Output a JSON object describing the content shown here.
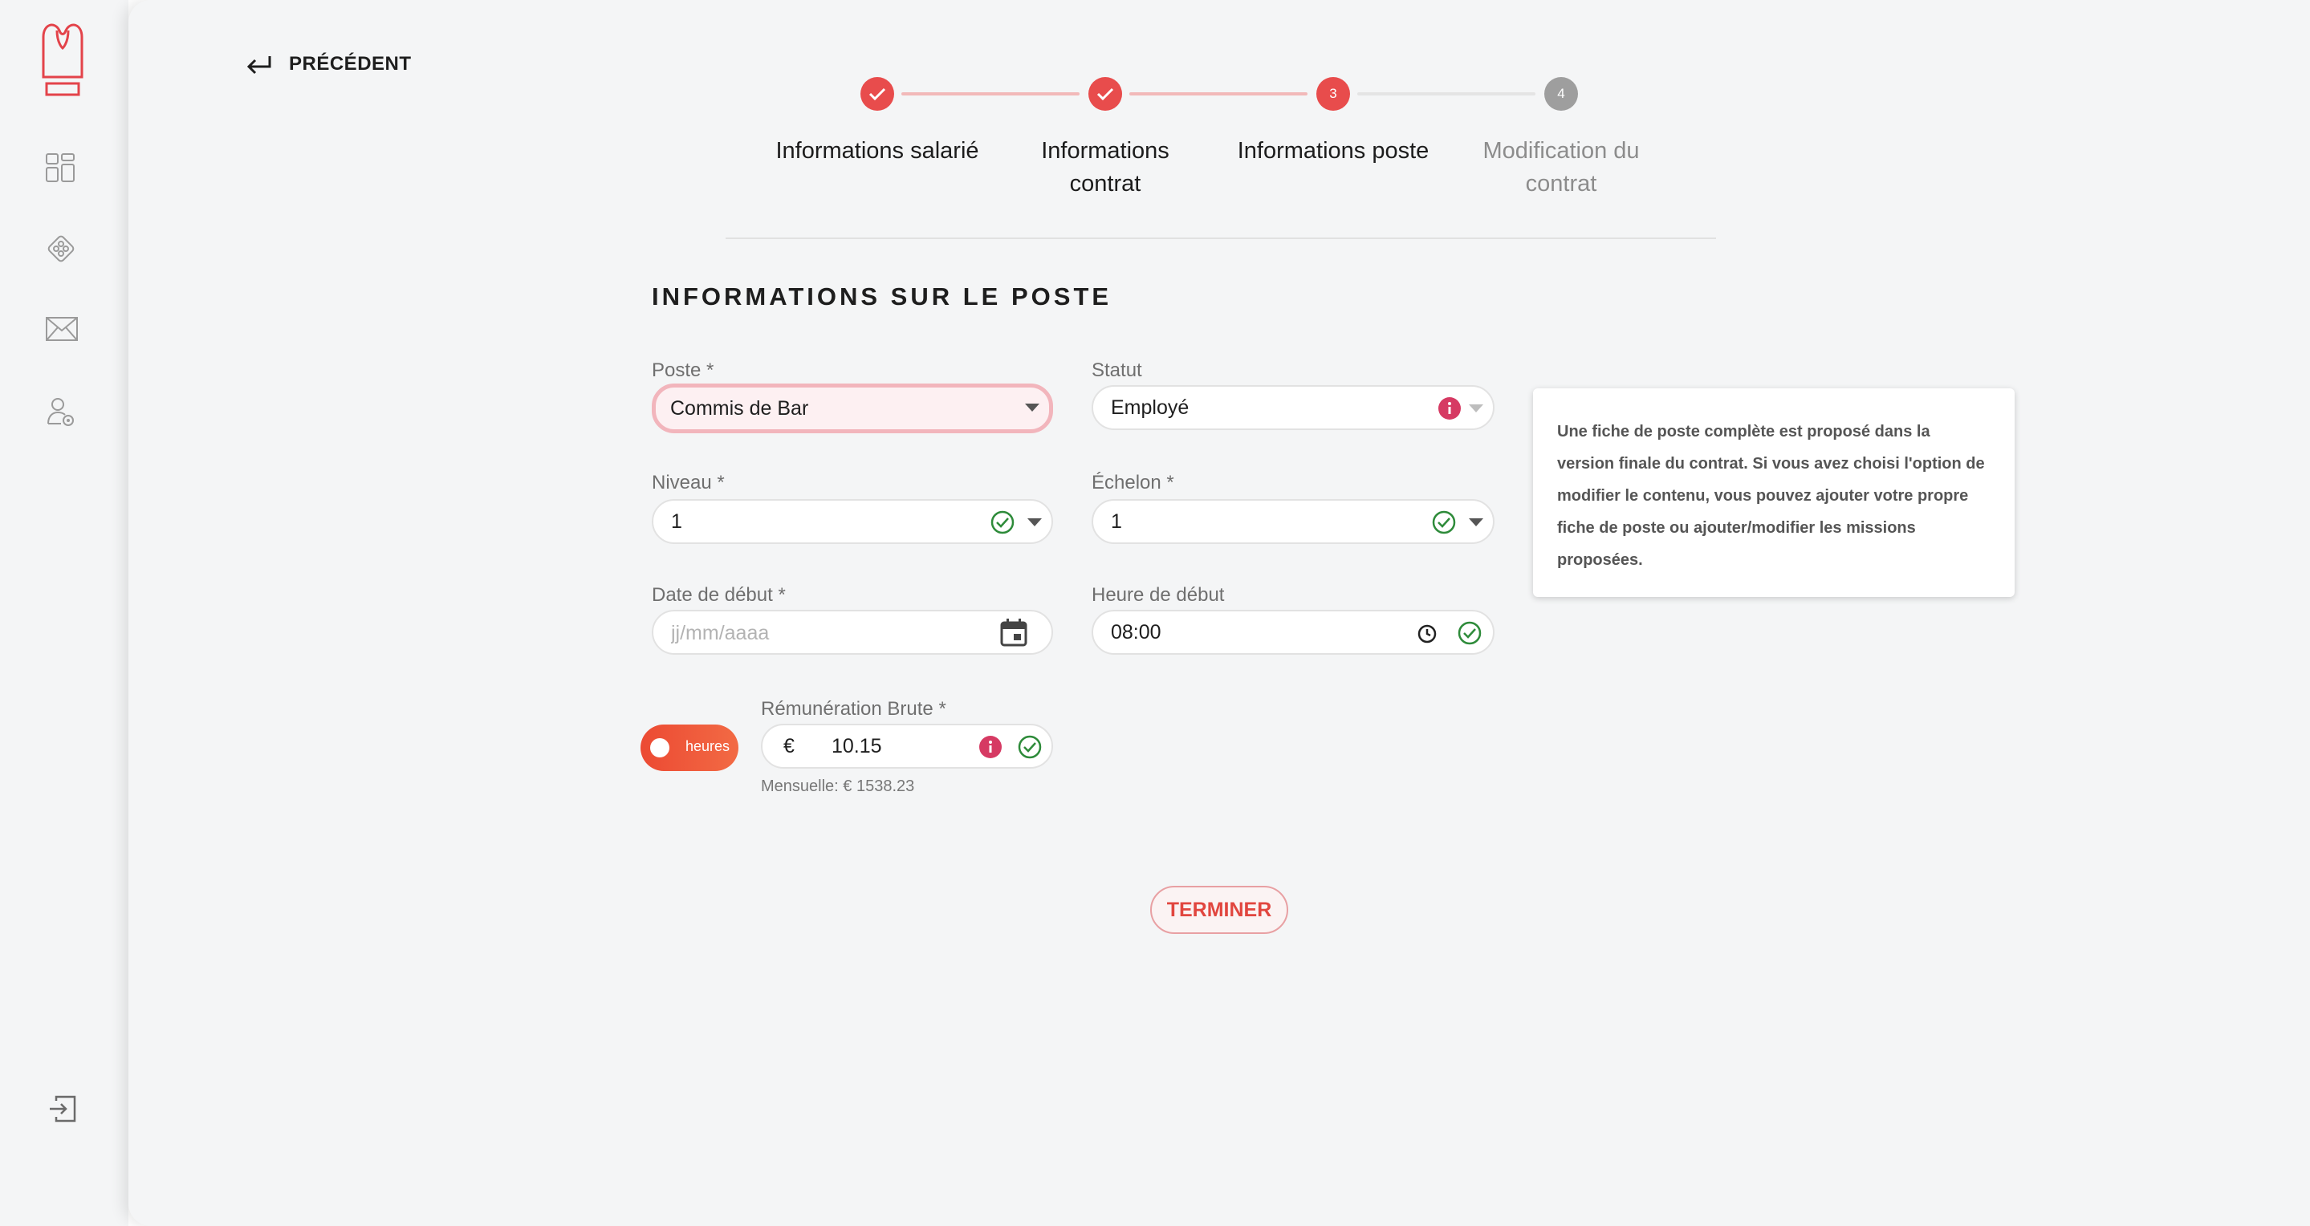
{
  "nav": {
    "back_label": "PRÉCÉDENT"
  },
  "stepper": {
    "steps": [
      {
        "label": "Informations salarié",
        "state": "done"
      },
      {
        "label": "Informations contrat",
        "state": "done"
      },
      {
        "label": "Informations poste",
        "state": "current",
        "number": "3"
      },
      {
        "label": "Modification du contrat",
        "state": "pending",
        "number": "4"
      }
    ]
  },
  "section": {
    "title": "INFORMATIONS SUR LE POSTE"
  },
  "form": {
    "poste": {
      "label": "Poste *",
      "value": "Commis de Bar"
    },
    "statut": {
      "label": "Statut",
      "value": "Employé"
    },
    "niveau": {
      "label": "Niveau *",
      "value": "1"
    },
    "echelon": {
      "label": "Échelon *",
      "value": "1"
    },
    "date_debut": {
      "label": "Date de début *",
      "placeholder": "jj/mm/aaaa",
      "value": ""
    },
    "heure_debut": {
      "label": "Heure de début",
      "value": "08:00"
    },
    "remuneration": {
      "label": "Rémunération Brute *",
      "currency": "€",
      "value": "10.15",
      "toggle_label": "heures",
      "monthly": "Mensuelle: € 1538.23"
    }
  },
  "info_card": {
    "text": "Une fiche de poste complète est proposé dans la version finale du contrat. Si vous avez choisi l'option de modifier le contenu, vous pouvez ajouter votre propre fiche de poste ou ajouter/modifier les missions proposées."
  },
  "actions": {
    "finish_label": "TERMINER"
  },
  "colors": {
    "accent": "#e84c4c",
    "success": "#2e8b3a",
    "info": "#d63a63",
    "pending": "#9e9e9e"
  },
  "icons": {
    "sidebar": [
      "chef-hat-logo-icon",
      "dashboard-icon",
      "diamond-grid-icon",
      "mail-icon",
      "user-settings-icon",
      "logout-icon"
    ]
  }
}
